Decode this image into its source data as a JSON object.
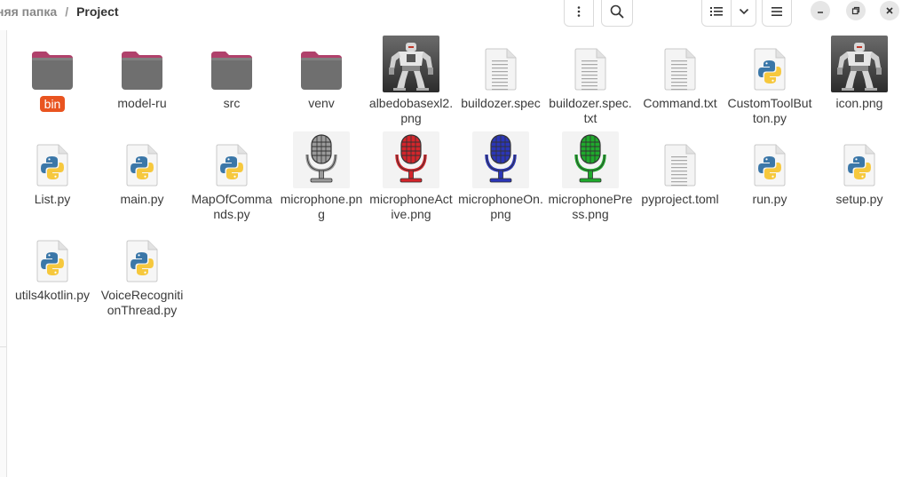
{
  "breadcrumb": {
    "parent": "няя папка",
    "separator": "/",
    "current": "Project"
  },
  "toolbar": {
    "menu_icon": "vertical-dots-icon",
    "search_icon": "search-icon",
    "view_icon": "list-view-icon",
    "view_dropdown_icon": "chevron-down-icon",
    "hamburger_icon": "hamburger-menu-icon"
  },
  "window_controls": {
    "minimize_icon": "minimize-icon",
    "maximize_icon": "restore-icon",
    "close_icon": "close-icon"
  },
  "colors": {
    "selection": "#e95420",
    "folder": "#6f6f6f",
    "folder_tab": "#b0416b"
  },
  "files": [
    {
      "name": "bin",
      "type": "folder",
      "selected": true
    },
    {
      "name": "model-ru",
      "type": "folder"
    },
    {
      "name": "src",
      "type": "folder"
    },
    {
      "name": "venv",
      "type": "folder"
    },
    {
      "name": "albedobasexl2.png",
      "type": "robot-image"
    },
    {
      "name": "buildozer.spec",
      "type": "text"
    },
    {
      "name": "buildozer.spec.txt",
      "type": "text"
    },
    {
      "name": "Command.txt",
      "type": "text"
    },
    {
      "name": "CustomToolButton.py",
      "type": "python"
    },
    {
      "name": "icon.png",
      "type": "robot-image"
    },
    {
      "name": "List.py",
      "type": "python"
    },
    {
      "name": "main.py",
      "type": "python"
    },
    {
      "name": "MapOfCommands.py",
      "type": "python"
    },
    {
      "name": "microphone.png",
      "type": "mic",
      "color": "#9a9a9a"
    },
    {
      "name": "microphoneActive.png",
      "type": "mic",
      "color": "#d4252b"
    },
    {
      "name": "microphoneOn.png",
      "type": "mic",
      "color": "#2b36b8"
    },
    {
      "name": "microphonePress.png",
      "type": "mic",
      "color": "#1faa2c"
    },
    {
      "name": "pyproject.toml",
      "type": "text"
    },
    {
      "name": "run.py",
      "type": "python"
    },
    {
      "name": "setup.py",
      "type": "python"
    },
    {
      "name": "utils4kotlin.py",
      "type": "python"
    },
    {
      "name": "VoiceRecognitionThread.py",
      "type": "python"
    }
  ]
}
